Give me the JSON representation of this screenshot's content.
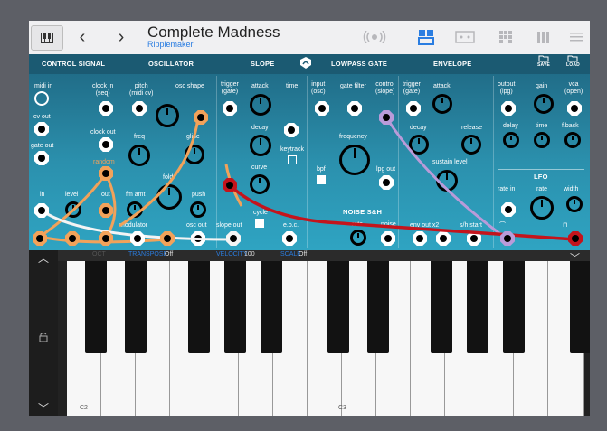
{
  "toolbar": {
    "keyboard_icon": "piano-keys-icon",
    "back": "‹",
    "forward": "›",
    "title": "Complete Madness",
    "subtitle": "Ripplemaker",
    "right_icons": [
      "radio-waves-icon",
      "modules-icon",
      "grid-icon",
      "matrix-icon",
      "bars-icon",
      "menu-icon"
    ]
  },
  "sections": {
    "control_signal": "CONTROL SIGNAL",
    "oscillator": "OSCILLATOR",
    "slope": "SLOPE",
    "lowpass_gate": "LOWPASS GATE",
    "envelope": "ENVELOPE",
    "save": "SAVE",
    "load": "LOAD",
    "noise": "NOISE S&H",
    "lfo": "LFO"
  },
  "labels": {
    "midi_in": "midi in",
    "cv_out": "cv out",
    "gate_out": "gate out",
    "clock_in": "clock in\n(seq)",
    "clock_out": "clock out",
    "random": "random",
    "in": "in",
    "level": "level",
    "out": "out",
    "pitch": "pitch\n(midi cv)",
    "osc_shape": "osc shape",
    "freq": "freq",
    "glide": "glide",
    "fm_amt": "fm amt",
    "fold": "fold",
    "push": "push",
    "modulator": "modulator",
    "osc_out": "osc out",
    "trigger_gate": "trigger\n(gate)",
    "attack": "attack",
    "time": "time",
    "decay": "decay",
    "keytrack": "keytrack",
    "curve": "curve",
    "cycle": "cycle",
    "eoc": "e.o.c.",
    "slope_out": "slope out",
    "input_osc": "input\n(osc)",
    "gate_filter": "gate filter",
    "control_slope": "control\n(slope)",
    "frequency": "frequency",
    "bpf": "bpf",
    "lpg_out": "lpg out",
    "noise_rate": "rate",
    "noise": "noise",
    "env_trigger": "trigger\n(gate)",
    "env_attack": "attack",
    "env_decay": "decay",
    "release": "release",
    "sustain_level": "sustain level",
    "env_out_x2": "env out x2",
    "sh_start": "s/h start",
    "output_lpg": "output\n(lpg)",
    "gain": "gain",
    "vca_open": "vca\n(open)",
    "delay": "delay",
    "delay_time": "time",
    "fback": "f.back",
    "rate_in": "rate in",
    "lfo_rate": "rate",
    "width": "width"
  },
  "keyboard_bar": {
    "octave": "OCT",
    "transpose_label": "TRANSPOSE",
    "transpose_value": "Off",
    "velocity_label": "VELOCITY",
    "velocity_value": "100",
    "scale_label": "SCALE",
    "scale_value": "Off"
  },
  "keyboard": {
    "note_c2": "C2",
    "note_c3": "C3"
  },
  "colors": {
    "cable_orange": "#f2a25a",
    "cable_white": "#f4f4f4",
    "cable_red": "#c4141c",
    "cable_lilac": "#b99bd9",
    "accent_blue": "#2a7de1"
  }
}
